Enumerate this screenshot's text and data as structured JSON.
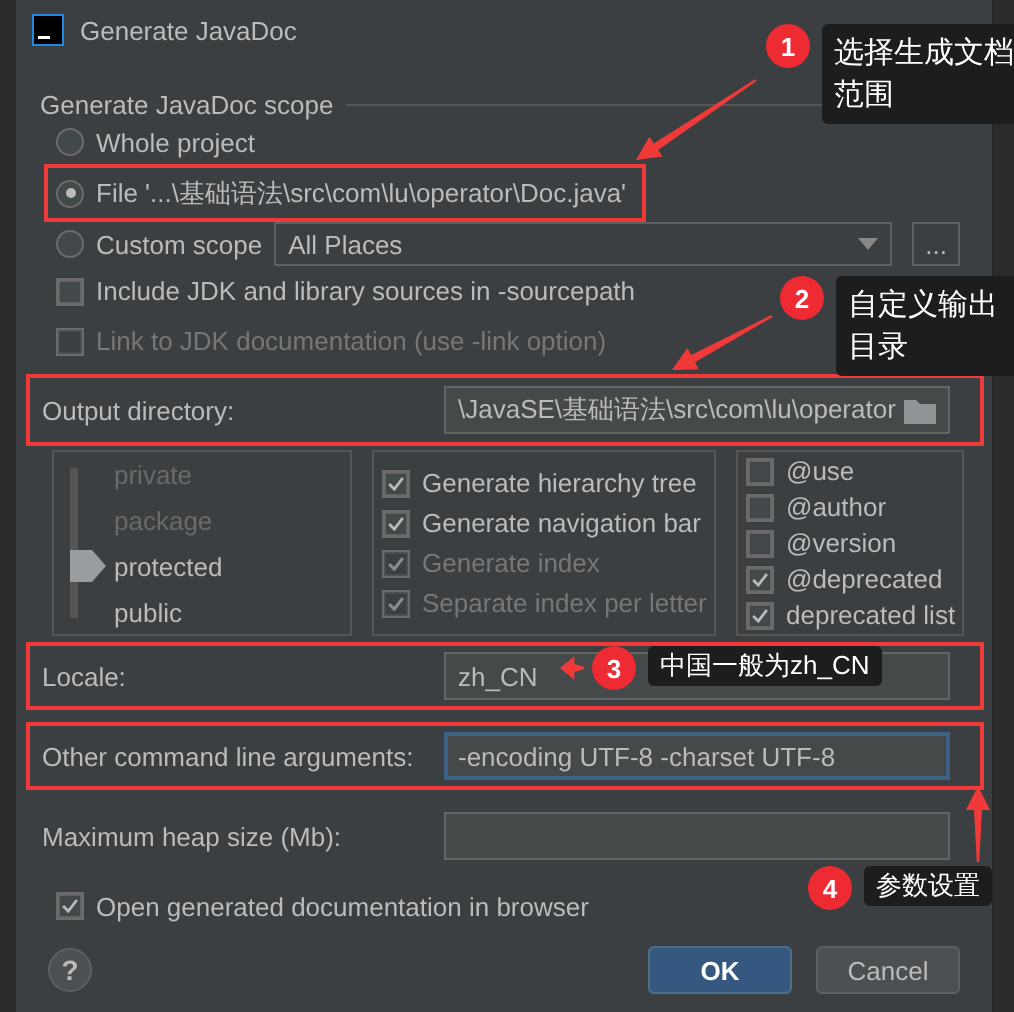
{
  "window": {
    "title": "Generate JavaDoc"
  },
  "scope": {
    "title": "Generate JavaDoc scope",
    "options": [
      {
        "label": "Whole project",
        "selected": false,
        "highlighted": false
      },
      {
        "label": "File '...\\基础语法\\src\\com\\lu\\operator\\Doc.java'",
        "selected": true,
        "highlighted": true
      },
      {
        "label": "Custom scope",
        "selected": false,
        "highlighted": false
      }
    ],
    "custom_scope": {
      "value": "All Places"
    },
    "browse_button": "..."
  },
  "options": [
    {
      "label": "Include JDK and library sources in -sourcepath",
      "checked": false,
      "disabled": false
    },
    {
      "label": "Link to JDK documentation (use -link option)",
      "checked": false,
      "disabled": true
    }
  ],
  "output_directory": {
    "label": "Output directory:",
    "value": "\\JavaSE\\基础语法\\src\\com\\lu\\operator",
    "highlighted": true
  },
  "visibility": [
    {
      "label": "private",
      "selected": false
    },
    {
      "label": "package",
      "selected": false
    },
    {
      "label": "protected",
      "selected": true
    },
    {
      "label": "public",
      "selected": false
    }
  ],
  "generate_options": [
    {
      "label": "Generate hierarchy tree",
      "checked": true,
      "disabled": false
    },
    {
      "label": "Generate navigation bar",
      "checked": true,
      "disabled": false
    },
    {
      "label": "Generate index",
      "checked": true,
      "disabled": true
    },
    {
      "label": "Separate index per letter",
      "checked": true,
      "disabled": true
    }
  ],
  "tags": [
    {
      "label": "@use",
      "checked": false,
      "disabled": false
    },
    {
      "label": "@author",
      "checked": false,
      "disabled": false
    },
    {
      "label": "@version",
      "checked": false,
      "disabled": false
    },
    {
      "label": "@deprecated",
      "checked": true,
      "disabled": false
    },
    {
      "label": "deprecated list",
      "checked": true,
      "disabled": false
    }
  ],
  "fields": [
    {
      "label": "Locale:",
      "value": "zh_CN",
      "highlighted": true,
      "focused": false
    },
    {
      "label": "Other command line arguments:",
      "value": "-encoding UTF-8 -charset UTF-8",
      "highlighted": true,
      "focused": true
    },
    {
      "label": "Maximum heap size (Mb):",
      "highlighted": false,
      "focused": false
    }
  ],
  "open_in_browser": {
    "label": "Open generated documentation in browser",
    "checked": true,
    "disabled": false
  },
  "help_button": "?",
  "buttons": [
    {
      "label": "OK",
      "kind": "primary"
    },
    {
      "label": "Cancel",
      "kind": "secondary"
    }
  ],
  "annotations": [
    {
      "number": "1",
      "text": "选择生成文档范围"
    },
    {
      "number": "2",
      "text": "自定义输出目录"
    },
    {
      "number": "3",
      "text": "中国一般为zh_CN"
    },
    {
      "number": "4",
      "text": "参数设置"
    }
  ]
}
